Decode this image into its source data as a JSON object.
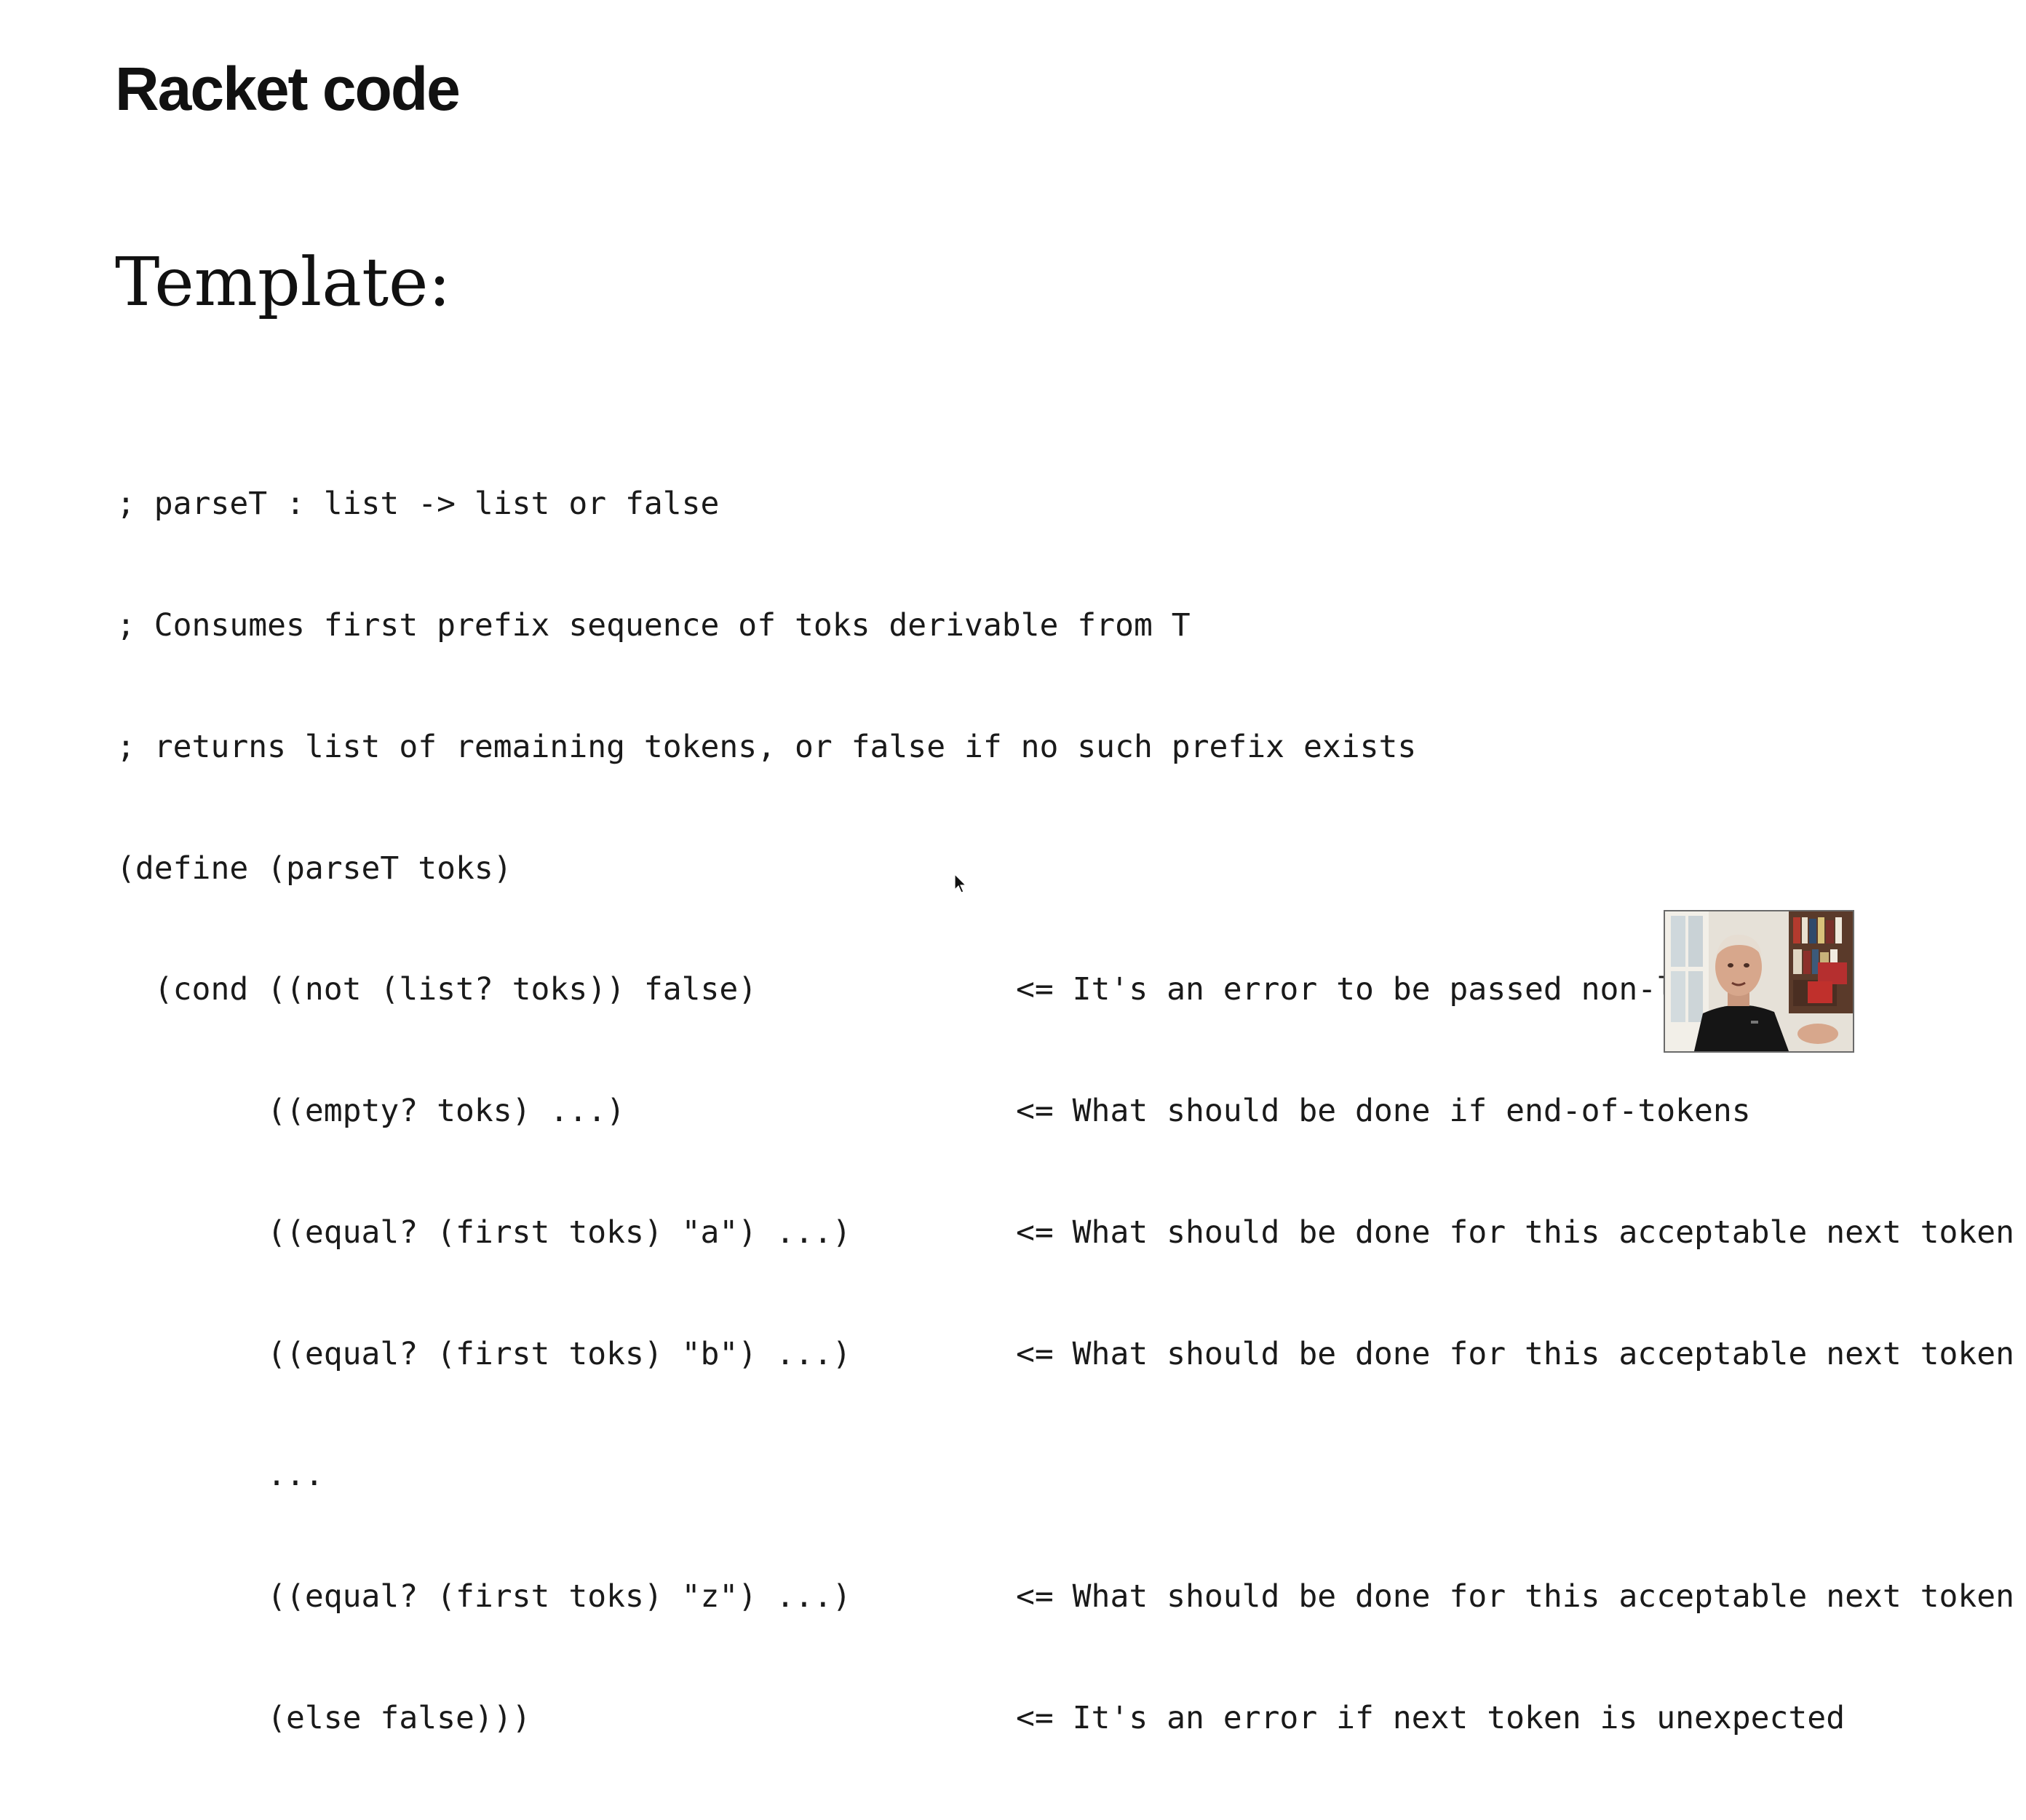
{
  "slide": {
    "title": "Racket code",
    "subtitle": "Template:"
  },
  "code": {
    "lines": [
      {
        "code": "; parseT : list -> list or false",
        "note": ""
      },
      {
        "code": "; Consumes first prefix sequence of toks derivable from T",
        "note": ""
      },
      {
        "code": "; returns list of remaining tokens, or false if no such prefix exists",
        "note": ""
      },
      {
        "code": "(define (parseT toks)",
        "note": ""
      },
      {
        "code": "  (cond ((not (list? toks)) false)",
        "note": "<= It's an error to be passed non-list"
      },
      {
        "code": "        ((empty? toks) ...)",
        "note": "<= What should be done if end-of-tokens"
      },
      {
        "code": "        ((equal? (first toks) \"a\") ...)",
        "note": "<= What should be done for this acceptable next token"
      },
      {
        "code": "        ((equal? (first toks) \"b\") ...)",
        "note": "<= What should be done for this acceptable next token"
      },
      {
        "code": "        ...",
        "note": ""
      },
      {
        "code": "        ((equal? (first toks) \"z\") ...)",
        "note": "<= What should be done for this acceptable next token"
      },
      {
        "code": "        (else false)))",
        "note": "<= It's an error if next token is unexpected"
      }
    ]
  },
  "colors": {
    "background": "#ffffff",
    "text": "#111111"
  },
  "icons": {
    "cursor": "mouse-pointer-icon",
    "webcam": "presenter-webcam-thumbnail"
  }
}
